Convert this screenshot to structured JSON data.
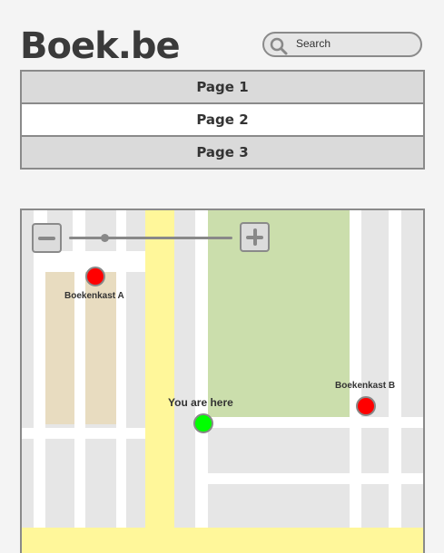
{
  "header": {
    "logo": "Boek.be"
  },
  "search": {
    "placeholder": "Search",
    "icon": "search-icon"
  },
  "nav": {
    "items": [
      {
        "label": "Page 1",
        "active": false
      },
      {
        "label": "Page 2",
        "active": true
      },
      {
        "label": "Page 3",
        "active": false
      }
    ]
  },
  "map": {
    "zoom_out_icon": "minus-icon",
    "zoom_in_icon": "plus-icon",
    "zoom_level": 0.22,
    "markers": [
      {
        "label": "Boekenkast A",
        "color": "#ff0000"
      },
      {
        "label": "You are here",
        "color": "#00ff00"
      },
      {
        "label": "Boekenkast B",
        "color": "#ff0000"
      }
    ],
    "colors": {
      "block": "#e6e6e6",
      "park": "#cbdeac",
      "building": "#e8dcc0",
      "main_road": "#fff79a",
      "road": "#ffffff"
    }
  }
}
